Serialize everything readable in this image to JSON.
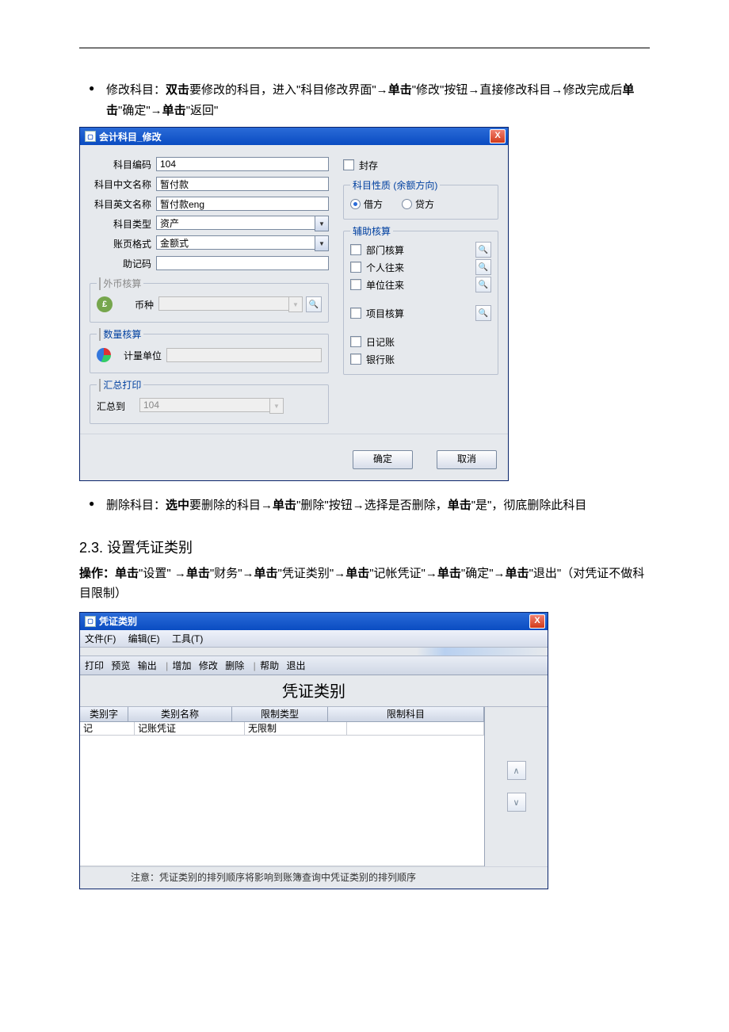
{
  "doc": {
    "bullet1_pre": "修改科目：",
    "bullet1_b1": "双击",
    "bullet1_mid1": "要修改的科目，进入\"科目修改界面\"→",
    "bullet1_b2": "单击",
    "bullet1_mid2": "\"修改\"按钮→直接修改科目→修改完成后",
    "bullet1_b3": "单击",
    "bullet1_mid3": "\"确定\"→",
    "bullet1_b4": "单击",
    "bullet1_end": "\"返回\"",
    "bullet2_pre": "删除科目：",
    "bullet2_b1": "选中",
    "bullet2_mid1": "要删除的科目→",
    "bullet2_b2": "单击",
    "bullet2_mid2": "\"删除\"按钮→选择是否删除，",
    "bullet2_b3": "单击",
    "bullet2_end": "\"是\"，彻底删除此科目",
    "heading": "2.3. 设置凭证类别",
    "op_label": "操作：",
    "op_b1": "单击",
    "op_t1": "\"设置\" →",
    "op_b2": "单击",
    "op_t2": "\"财务\"→",
    "op_b3": "单击",
    "op_t3": "\"凭证类别\"→",
    "op_b4": "单击",
    "op_t4": "\"记帐凭证\"→",
    "op_b5": "单击",
    "op_t5": "\"确定\"→",
    "op_b6": "单击",
    "op_t6": "\"退出\"（对凭证不做科目限制）"
  },
  "dlg1": {
    "title": "会计科目_修改",
    "close_x": "X",
    "labels": {
      "code": "科目编码",
      "cn_name": "科目中文名称",
      "en_name": "科目英文名称",
      "type": "科目类型",
      "ledger_fmt": "账页格式",
      "mnemo": "助记码",
      "fx_group": "外币核算",
      "currency": "币种",
      "qty_group": "数量核算",
      "unit": "计量单位",
      "sum_group": "汇总打印",
      "sum_to": "汇总到",
      "seal": "封存",
      "nature_group": "科目性质 (余额方向)",
      "debit": "借方",
      "credit": "贷方",
      "aux_group": "辅助核算",
      "dept": "部门核算",
      "personal": "个人往来",
      "company": "单位往来",
      "project": "项目核算",
      "journal": "日记账",
      "bank": "银行账"
    },
    "values": {
      "code": "104",
      "cn_name": "暂付款",
      "en_name": "暂付款eng",
      "type": "资产",
      "ledger_fmt": "金额式",
      "mnemo": "",
      "currency": "",
      "sum_to": "104"
    },
    "buttons": {
      "ok": "确定",
      "cancel": "取消"
    }
  },
  "dlg2": {
    "title": "凭证类别",
    "close_x": "X",
    "menus": {
      "file": "文件(F)",
      "edit": "编辑(E)",
      "tool": "工具(T)"
    },
    "toolbar": {
      "print": "打印",
      "preview": "预览",
      "export": "输出",
      "add": "增加",
      "modify": "修改",
      "delete": "删除",
      "help": "帮助",
      "exit": "退出"
    },
    "panel_title": "凭证类别",
    "columns": {
      "c0": "类别字",
      "c1": "类别名称",
      "c2": "限制类型",
      "c3": "限制科目"
    },
    "row": {
      "c0": "记",
      "c1": "记账凭证",
      "c2": "无限制",
      "c3": ""
    },
    "note": "注意：凭证类别的排列顺序将影响到账簿查询中凭证类别的排列顺序"
  }
}
